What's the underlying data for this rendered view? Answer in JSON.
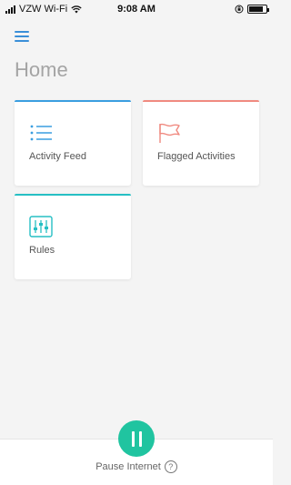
{
  "status_bar": {
    "carrier": "VZW Wi-Fi",
    "time": "9:08 AM",
    "battery_level": 0.85
  },
  "header": {
    "menu_icon": "hamburger-menu-icon",
    "title": "Home"
  },
  "cards": [
    {
      "label": "Activity Feed",
      "icon": "list-icon",
      "accent": "#3a9ee0"
    },
    {
      "label": "Flagged Activities",
      "icon": "flag-icon",
      "accent": "#f08a80"
    },
    {
      "label": "Rules",
      "icon": "sliders-icon",
      "accent": "#26bfc4"
    }
  ],
  "bottom": {
    "pause_label": "Pause Internet",
    "help_glyph": "?",
    "pause_color": "#20c4a0"
  }
}
